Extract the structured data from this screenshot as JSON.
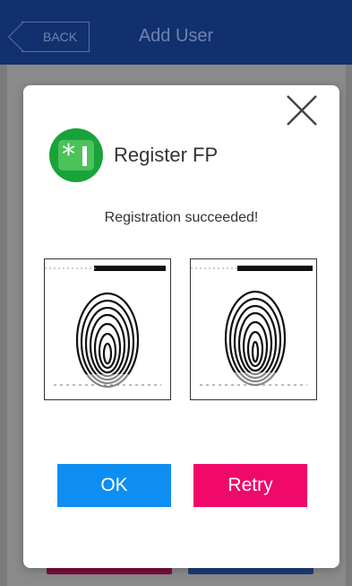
{
  "header": {
    "back_label": "BACK",
    "title": "Add User"
  },
  "dialog": {
    "title": "Register FP",
    "icon": "fingerprint-register-icon",
    "status": "Registration succeeded!",
    "ok_label": "OK",
    "retry_label": "Retry",
    "close_icon": "close-icon"
  },
  "colors": {
    "header_bg": "#13306e",
    "ok_button": "#0e8ef2",
    "retry_button": "#f0096a",
    "icon_green": "#19a33a"
  }
}
